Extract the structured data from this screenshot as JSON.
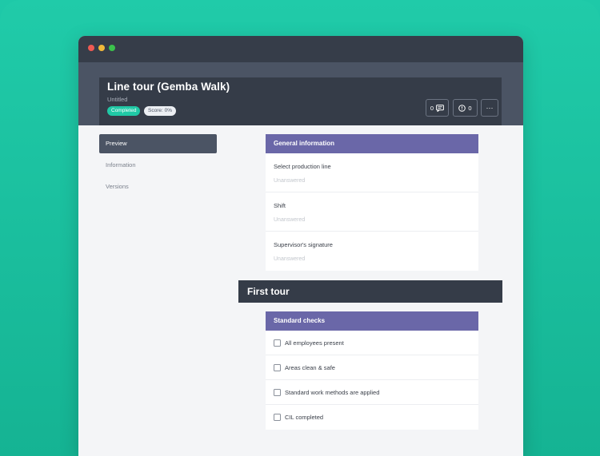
{
  "colors": {
    "teal_background": "#1ec9a8",
    "titlebar": "#363d49",
    "header_band": "#4b5464",
    "section_header": "#6a67a8",
    "completed_badge": "#20c9a6"
  },
  "window": {
    "traffic_lights": [
      "close",
      "minimize",
      "maximize"
    ]
  },
  "header": {
    "title": "Line tour (Gemba Walk)",
    "subtitle": "Untitled",
    "status_badge": "Completed",
    "score_badge": "Score: 0%",
    "comments_count": "0",
    "comments_icon": "comment-icon",
    "issues_count": "0",
    "issues_icon": "alert-circle-icon",
    "more_label": "···"
  },
  "sidebar": {
    "items": [
      {
        "label": "Preview",
        "active": true
      },
      {
        "label": "Information",
        "active": false
      },
      {
        "label": "Versions",
        "active": false
      }
    ]
  },
  "general_section": {
    "title": "General information",
    "fields": [
      {
        "label": "Select production line",
        "value": "Unanswered"
      },
      {
        "label": "Shift",
        "value": "Unanswered"
      },
      {
        "label": "Supervisor's signature",
        "value": "Unanswered"
      }
    ]
  },
  "tour_banner": {
    "title": "First tour"
  },
  "standard_section": {
    "title": "Standard checks",
    "checks": [
      {
        "label": "All employees present",
        "checked": false
      },
      {
        "label": "Areas clean & safe",
        "checked": false
      },
      {
        "label": "Standard work methods are applied",
        "checked": false
      },
      {
        "label": "CIL completed",
        "checked": false
      }
    ]
  }
}
